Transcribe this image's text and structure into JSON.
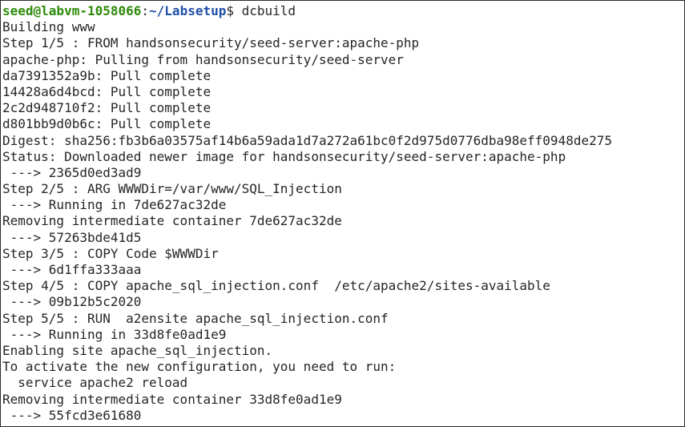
{
  "terminal": {
    "prompt": {
      "user_host": "seed@labvm-1058066",
      "separator": ":",
      "path": "~/Labsetup",
      "symbol": "$",
      "command": " dcbuild"
    },
    "output_lines": [
      "Building www",
      "Step 1/5 : FROM handsonsecurity/seed-server:apache-php",
      "apache-php: Pulling from handsonsecurity/seed-server",
      "da7391352a9b: Pull complete",
      "14428a6d4bcd: Pull complete",
      "2c2d948710f2: Pull complete",
      "d801bb9d0b6c: Pull complete",
      "Digest: sha256:fb3b6a03575af14b6a59ada1d7a272a61bc0f2d975d0776dba98eff0948de275",
      "Status: Downloaded newer image for handsonsecurity/seed-server:apache-php",
      " ---> 2365d0ed3ad9",
      "Step 2/5 : ARG WWWDir=/var/www/SQL_Injection",
      " ---> Running in 7de627ac32de",
      "Removing intermediate container 7de627ac32de",
      " ---> 57263bde41d5",
      "Step 3/5 : COPY Code $WWWDir",
      " ---> 6d1ffa333aaa",
      "Step 4/5 : COPY apache_sql_injection.conf  /etc/apache2/sites-available",
      " ---> 09b12b5c2020",
      "Step 5/5 : RUN  a2ensite apache_sql_injection.conf",
      " ---> Running in 33d8fe0ad1e9",
      "Enabling site apache_sql_injection.",
      "To activate the new configuration, you need to run:",
      "  service apache2 reload",
      "Removing intermediate container 33d8fe0ad1e9",
      " ---> 55fcd3e61680"
    ],
    "colors": {
      "user_host": "#2d8a0a",
      "path": "#1f4fa8",
      "text": "#262626",
      "background": "#ffffff"
    }
  }
}
